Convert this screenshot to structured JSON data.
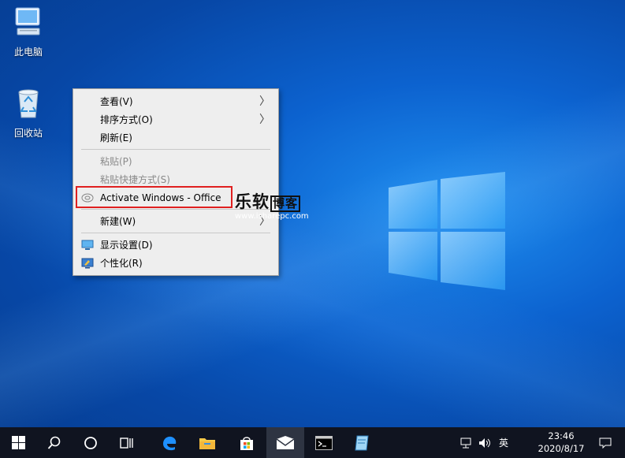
{
  "desktop": {
    "icons": [
      {
        "label": "此电脑",
        "icon": "computer-icon"
      },
      {
        "label": "回收站",
        "icon": "recycle-bin-icon"
      }
    ]
  },
  "context_menu": {
    "items": [
      {
        "label": "查看(V)",
        "submenu": true,
        "enabled": true
      },
      {
        "label": "排序方式(O)",
        "submenu": true,
        "enabled": true
      },
      {
        "label": "刷新(E)",
        "enabled": true
      },
      {
        "label": "粘贴(P)",
        "enabled": false
      },
      {
        "label": "粘贴快捷方式(S)",
        "enabled": false
      },
      {
        "label": "Activate Windows - Office",
        "icon": "activate-icon",
        "highlighted": true,
        "enabled": true
      },
      {
        "label": "新建(W)",
        "submenu": true,
        "enabled": true
      },
      {
        "label": "显示设置(D)",
        "icon": "display-icon",
        "enabled": true
      },
      {
        "label": "个性化(R)",
        "icon": "personalize-icon",
        "enabled": true
      }
    ],
    "arrow_glyph": "〉"
  },
  "watermark": {
    "brand": "乐软",
    "brand_box": "博客",
    "url": "www.isharepc.com"
  },
  "taskbar": {
    "apps": [
      "start-icon",
      "search-icon",
      "cortana-icon",
      "task-view-icon",
      "edge-icon",
      "file-explorer-icon",
      "store-icon",
      "mail-icon",
      "terminal-icon",
      "notepad-icon"
    ],
    "tray": {
      "ime": "英",
      "time": "23:46",
      "date": "2020/8/17"
    }
  },
  "colors": {
    "accent": "#0c62cf",
    "highlight_border": "#e02020",
    "taskbar": "#101420"
  }
}
